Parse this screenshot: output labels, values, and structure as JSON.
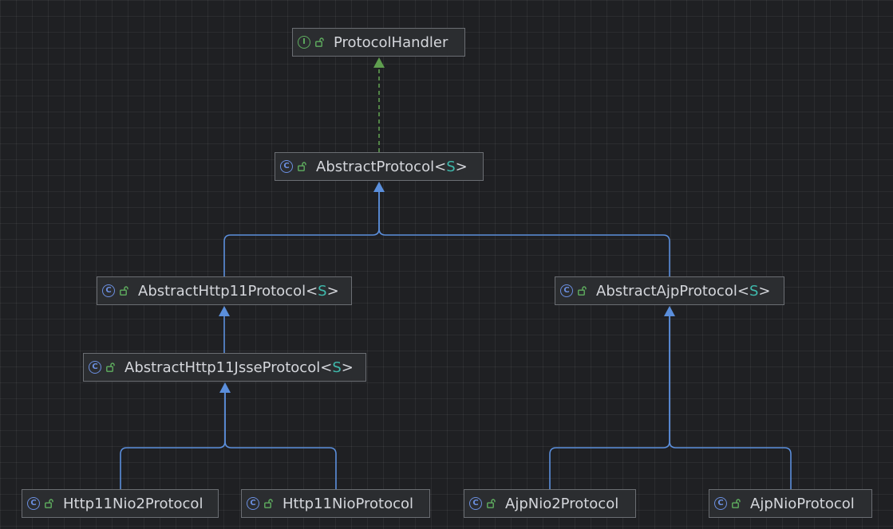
{
  "diagram": {
    "nodes": [
      {
        "id": "protocol-handler",
        "kind": "interface",
        "kind_glyph": "I",
        "name": "ProtocolHandler",
        "type_param": ""
      },
      {
        "id": "abstract-protocol",
        "kind": "class",
        "kind_glyph": "C",
        "name": "AbstractProtocol",
        "type_param": "S"
      },
      {
        "id": "abstract-http11-protocol",
        "kind": "class",
        "kind_glyph": "C",
        "name": "AbstractHttp11Protocol",
        "type_param": "S"
      },
      {
        "id": "abstract-ajp-protocol",
        "kind": "class",
        "kind_glyph": "C",
        "name": "AbstractAjpProtocol",
        "type_param": "S"
      },
      {
        "id": "abstract-http11-jsse-protocol",
        "kind": "class",
        "kind_glyph": "C",
        "name": "AbstractHttp11JsseProtocol",
        "type_param": "S"
      },
      {
        "id": "http11-nio2-protocol",
        "kind": "class",
        "kind_glyph": "C",
        "name": "Http11Nio2Protocol",
        "type_param": ""
      },
      {
        "id": "http11-nio-protocol",
        "kind": "class",
        "kind_glyph": "C",
        "name": "Http11NioProtocol",
        "type_param": ""
      },
      {
        "id": "ajp-nio2-protocol",
        "kind": "class",
        "kind_glyph": "C",
        "name": "AjpNio2Protocol",
        "type_param": ""
      },
      {
        "id": "ajp-nio-protocol",
        "kind": "class",
        "kind_glyph": "C",
        "name": "AjpNioProtocol",
        "type_param": ""
      }
    ],
    "edges": [
      {
        "from": "abstract-protocol",
        "to": "protocol-handler",
        "type": "implements"
      },
      {
        "from": "abstract-http11-protocol",
        "to": "abstract-protocol",
        "type": "extends"
      },
      {
        "from": "abstract-ajp-protocol",
        "to": "abstract-protocol",
        "type": "extends"
      },
      {
        "from": "abstract-http11-jsse-protocol",
        "to": "abstract-http11-protocol",
        "type": "extends"
      },
      {
        "from": "http11-nio2-protocol",
        "to": "abstract-http11-jsse-protocol",
        "type": "extends"
      },
      {
        "from": "http11-nio-protocol",
        "to": "abstract-http11-jsse-protocol",
        "type": "extends"
      },
      {
        "from": "ajp-nio2-protocol",
        "to": "abstract-ajp-protocol",
        "type": "extends"
      },
      {
        "from": "ajp-nio-protocol",
        "to": "abstract-ajp-protocol",
        "type": "extends"
      }
    ],
    "colors": {
      "extends_edge": "#5b8fdc",
      "implements_edge": "#5f9e4f",
      "class_icon": "#6b8fe0",
      "interface_icon": "#5fae5f",
      "lock_icon": "#5fae5f",
      "type_param": "#3fb9ac"
    },
    "icons": {
      "class": "class-icon",
      "interface": "interface-icon",
      "visibility": "public-lock-icon"
    }
  }
}
